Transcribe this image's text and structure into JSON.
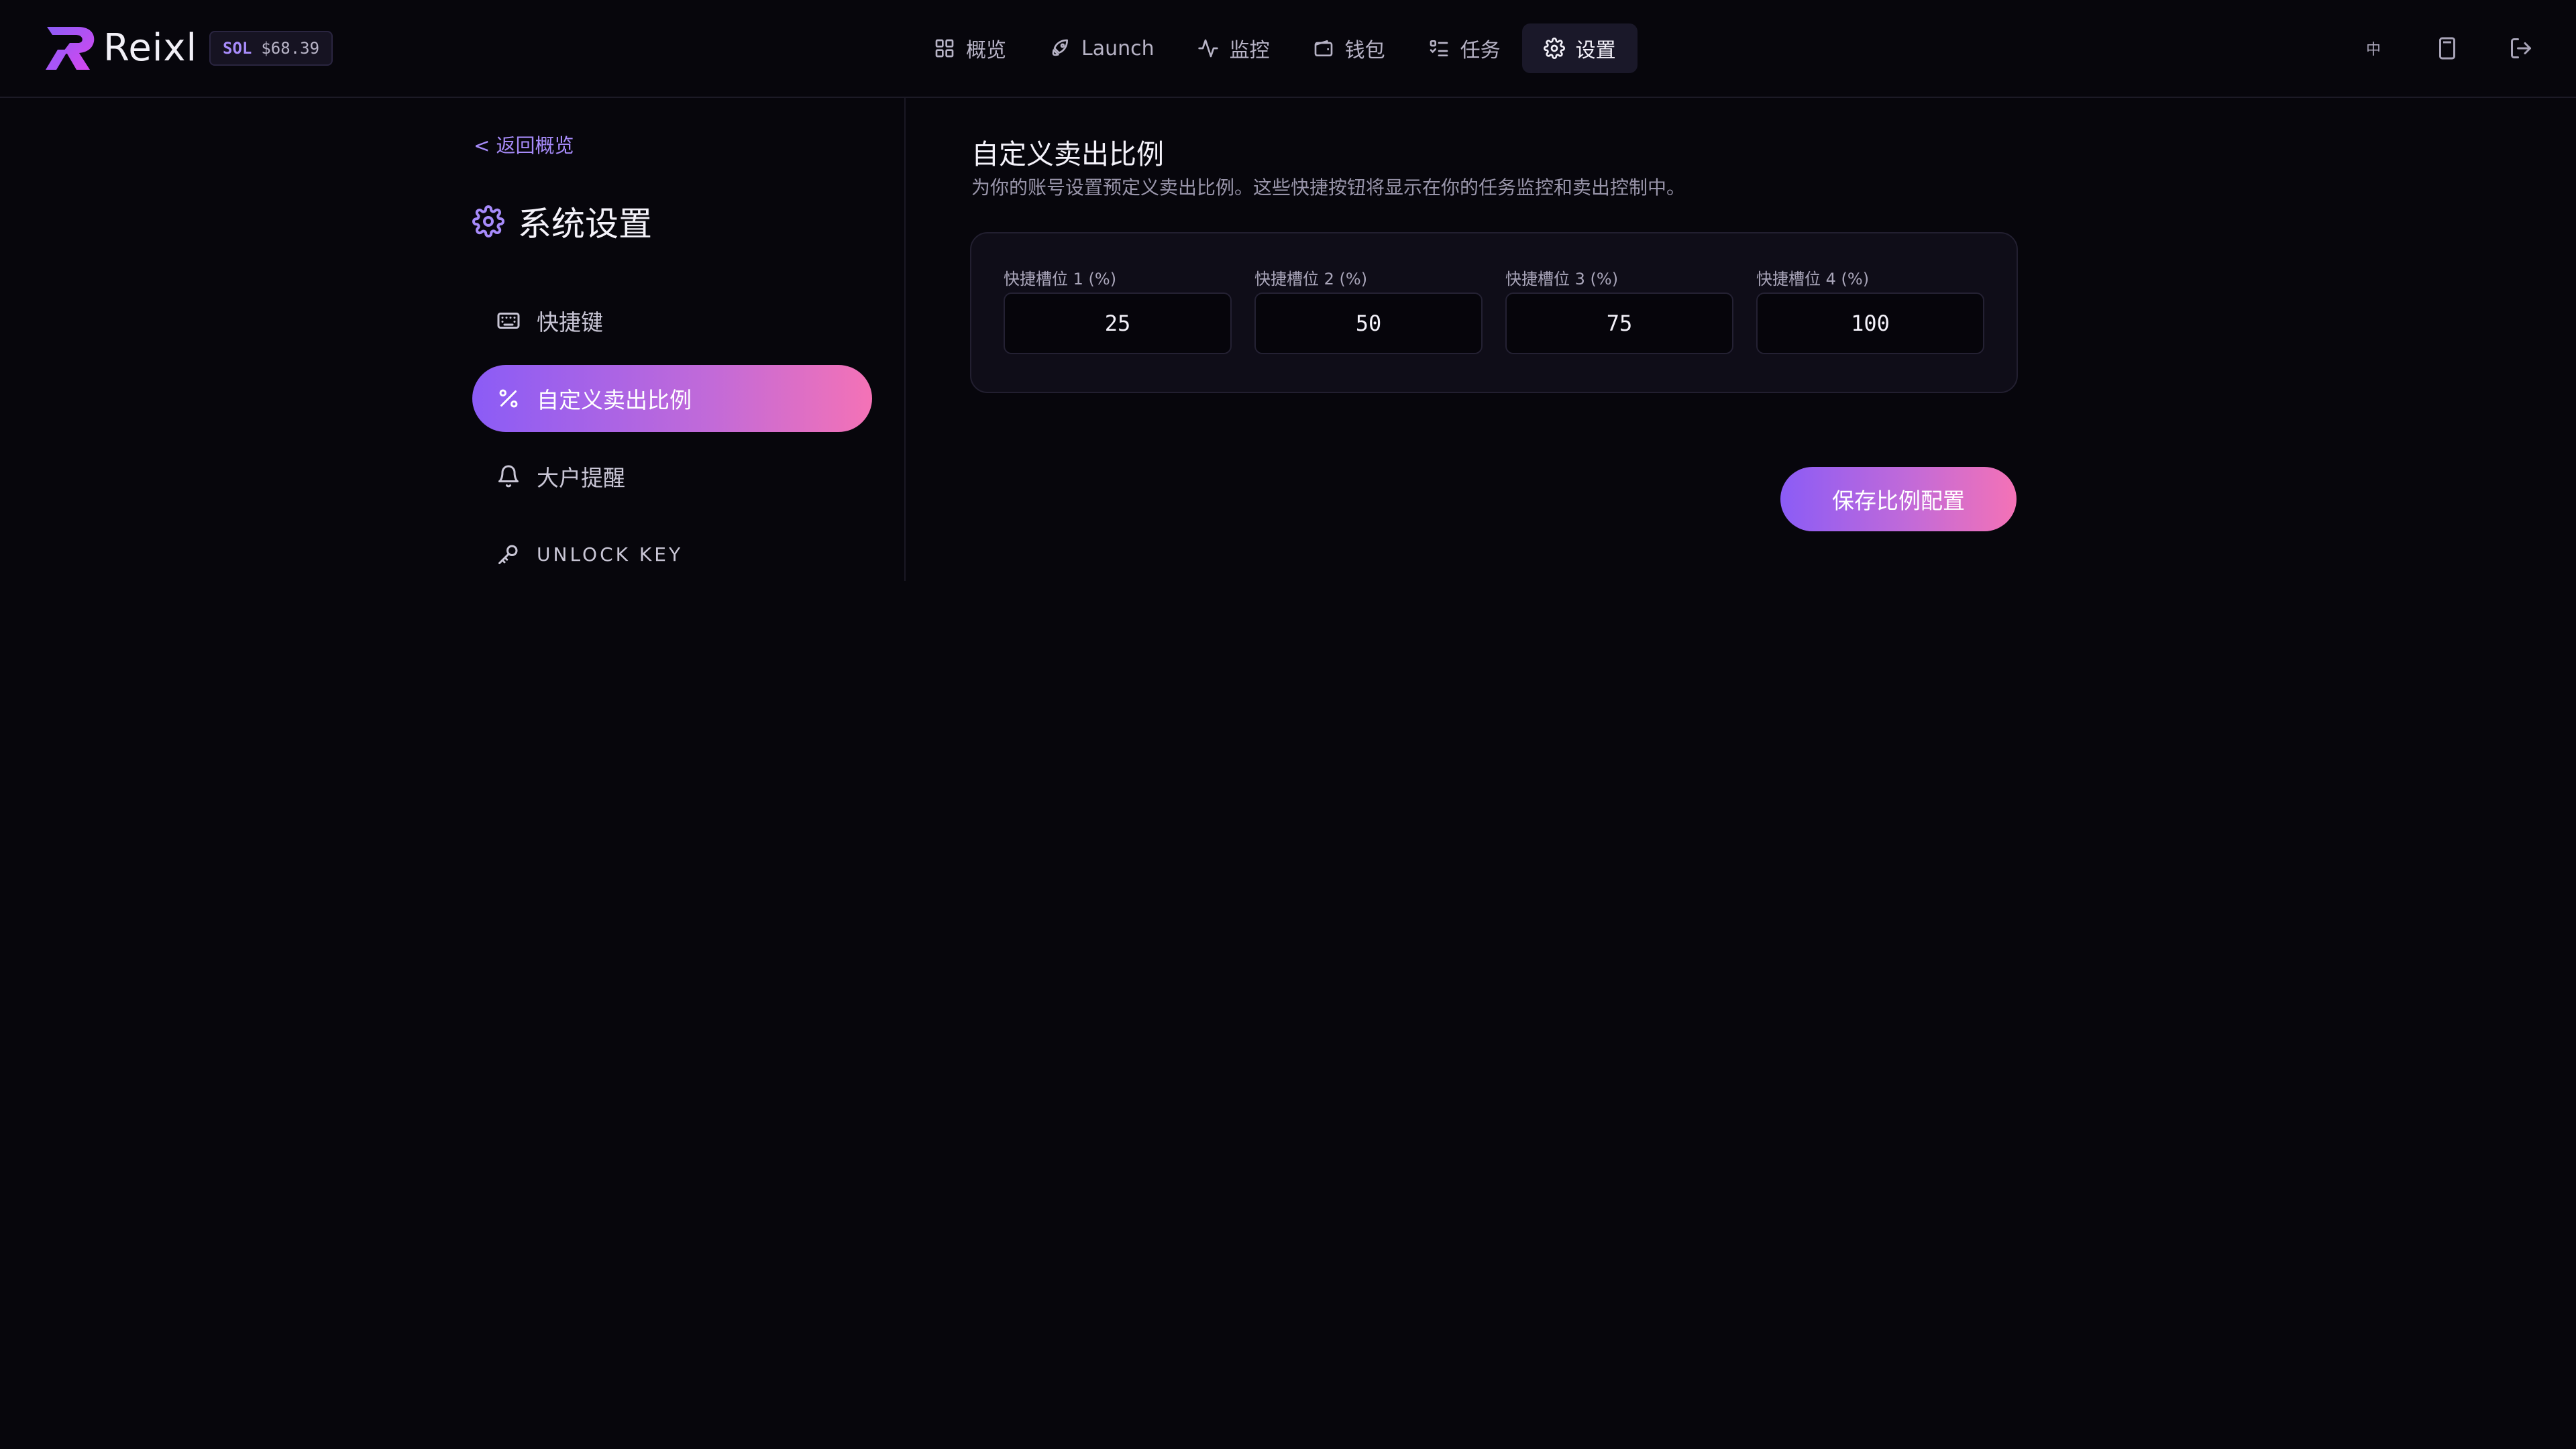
{
  "brand": {
    "name": "Reixl",
    "logo_icon": "reixl-logo"
  },
  "price": {
    "symbol": "SOL",
    "value": "$68.39"
  },
  "nav": {
    "items": [
      {
        "label": "概览",
        "icon": "dashboard-icon"
      },
      {
        "label": "Launch",
        "icon": "rocket-icon"
      },
      {
        "label": "监控",
        "icon": "activity-icon"
      },
      {
        "label": "钱包",
        "icon": "wallet-icon"
      },
      {
        "label": "任务",
        "icon": "list-check-icon"
      },
      {
        "label": "设置",
        "icon": "gear-icon",
        "active": true
      }
    ]
  },
  "top_actions": {
    "lang": "中"
  },
  "sidebar": {
    "back": "< 返回概览",
    "title": "系统设置",
    "items": [
      {
        "label": "快捷键",
        "icon": "keyboard-icon"
      },
      {
        "label": "自定义卖出比例",
        "icon": "percent-icon",
        "active": true
      },
      {
        "label": "大户提醒",
        "icon": "bell-icon"
      },
      {
        "label": "UNLOCK KEY",
        "icon": "key-icon"
      }
    ]
  },
  "main": {
    "title": "自定义卖出比例",
    "description": "为你的账号设置预定义卖出比例。这些快捷按钮将显示在你的任务监控和卖出控制中。",
    "slots": [
      {
        "label": "快捷槽位 1 (%)",
        "value": "25"
      },
      {
        "label": "快捷槽位 2 (%)",
        "value": "50"
      },
      {
        "label": "快捷槽位 3 (%)",
        "value": "75"
      },
      {
        "label": "快捷槽位 4 (%)",
        "value": "100"
      }
    ],
    "save_label": "保存比例配置"
  },
  "colors": {
    "background": "#07060c",
    "accent": "#8b5cf6",
    "accent_pink": "#f472b6"
  }
}
